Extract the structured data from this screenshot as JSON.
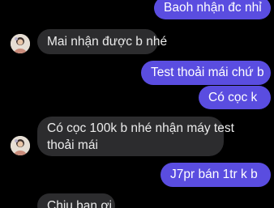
{
  "conversation": {
    "messages": [
      {
        "sender": "me",
        "text": "Baoh nhận đc nhỉ"
      },
      {
        "sender": "contact",
        "text": "Mai nhận được b nhé"
      },
      {
        "sender": "me",
        "text": "Test thoải mái chứ b"
      },
      {
        "sender": "me",
        "text": "Có cọc k"
      },
      {
        "sender": "contact",
        "line1": "Có cọc 100k b nhé nhận máy test",
        "line2": "thoải mái"
      },
      {
        "sender": "me",
        "text": "J7pr bán 1tr k b"
      },
      {
        "sender": "contact",
        "text": "Chịu bạn ơi"
      }
    ]
  },
  "colors": {
    "outgoing_bubble": "#5a4de0",
    "incoming_bubble": "#2c2c2e",
    "background": "#000000"
  },
  "icons": {
    "contact_avatar": "contact-avatar-icon"
  }
}
